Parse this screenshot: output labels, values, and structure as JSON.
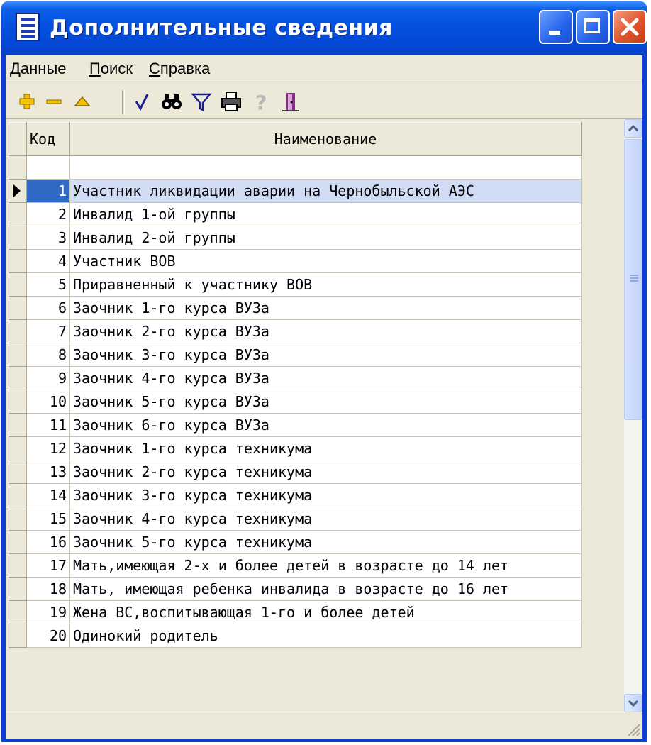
{
  "window": {
    "title": "Дополнительные сведения"
  },
  "menu": {
    "items": [
      {
        "label": "Данные"
      },
      {
        "label": "Поиск"
      },
      {
        "label": "Справка"
      }
    ]
  },
  "toolbar": {
    "buttons": [
      {
        "icon": "plus-icon",
        "color": "#f5c400"
      },
      {
        "icon": "minus-icon",
        "color": "#f5c400"
      },
      {
        "icon": "up-triangle-icon",
        "color": "#f5c400"
      },
      {
        "icon": "checkmark-icon",
        "color": "#1a1f8f"
      },
      {
        "icon": "binoculars-icon",
        "color": "#000000"
      },
      {
        "icon": "filter-icon",
        "color": "#1a1f8f"
      },
      {
        "icon": "printer-icon",
        "color": "#000000"
      },
      {
        "icon": "help-icon",
        "color": "#b8b8b8"
      },
      {
        "icon": "exit-door-icon",
        "color": "#8a2a8a"
      }
    ]
  },
  "grid": {
    "columns": [
      {
        "label": "Код"
      },
      {
        "label": "Наименование"
      }
    ],
    "selected_row": 0,
    "rows": [
      {
        "code": "1",
        "name": "Участник ликвидации аварии на Чернобыльской АЭС"
      },
      {
        "code": "2",
        "name": "Инвалид 1-ой группы"
      },
      {
        "code": "3",
        "name": "Инвалид 2-ой группы"
      },
      {
        "code": "4",
        "name": "Участник ВОВ"
      },
      {
        "code": "5",
        "name": "Приравненный к участнику ВОВ"
      },
      {
        "code": "6",
        "name": "Заочник 1-го курса ВУЗа"
      },
      {
        "code": "7",
        "name": "Заочник 2-го курса ВУЗа"
      },
      {
        "code": "8",
        "name": "Заочник 3-го курса ВУЗа"
      },
      {
        "code": "9",
        "name": "Заочник 4-го курса ВУЗа"
      },
      {
        "code": "10",
        "name": "Заочник 5-го курса ВУЗа"
      },
      {
        "code": "11",
        "name": "Заочник 6-го курса ВУЗа"
      },
      {
        "code": "12",
        "name": "Заочник 1-го курса техникума"
      },
      {
        "code": "13",
        "name": "Заочник 2-го курса техникума"
      },
      {
        "code": "14",
        "name": "Заочник 3-го курса техникума"
      },
      {
        "code": "15",
        "name": "Заочник 4-го курса техникума"
      },
      {
        "code": "16",
        "name": "Заочник 5-го курса техникума"
      },
      {
        "code": "17",
        "name": "Мать,имеющая 2-х и более детей в возрасте до 14 лет"
      },
      {
        "code": "18",
        "name": "Мать, имеющая ребенка инвалида в возрасте до 16 лет"
      },
      {
        "code": "19",
        "name": "Жена ВС,воспитывающая 1-го и более детей"
      },
      {
        "code": "20",
        "name": "Одинокий родитель"
      }
    ]
  },
  "colors": {
    "titlebar": "#0550df",
    "selection": "#316ac5",
    "face": "#ece9d8"
  }
}
